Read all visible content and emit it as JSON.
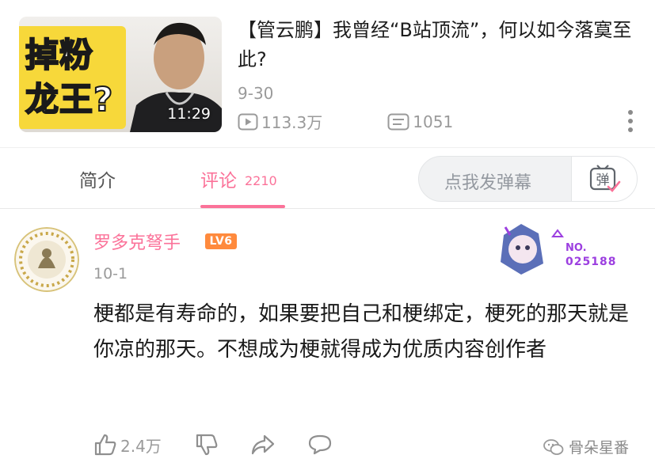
{
  "video": {
    "thumbnail_text_line1": "掉粉",
    "thumbnail_text_line2": "龙王?",
    "duration": "11:29",
    "title": "【管云鹏】我曾经“B站顶流”，何以如今落寞至此?",
    "date": "9-30",
    "views": "113.3万",
    "danmaku_count": "1051",
    "views_icon": "play-icon",
    "danmaku_icon": "danmaku-icon",
    "more_icon": "more-vertical-icon"
  },
  "tabs": {
    "intro_label": "简介",
    "comments_label": "评论",
    "comments_count": "2210",
    "active": "comments",
    "accent_color": "#fb7299"
  },
  "danmaku_input": {
    "placeholder": "点我发弹幕",
    "send_button_glyph": "弹"
  },
  "comment": {
    "user_name": "罗多克弩手",
    "level": "LV6",
    "date": "10-1",
    "fan_badge_label": "NO.",
    "fan_badge_number": "025188",
    "text": "梗都是有寿命的，如果要把自己和梗绑定，梗死的那天就是你凉的那天。不想成为梗就得成为优质内容创作者",
    "like_count": "2.4万",
    "like_icon": "thumb-up-icon",
    "dislike_icon": "thumb-down-icon",
    "share_icon": "share-icon",
    "reply_icon": "reply-icon"
  },
  "watermark": {
    "text": "骨朵星番"
  }
}
